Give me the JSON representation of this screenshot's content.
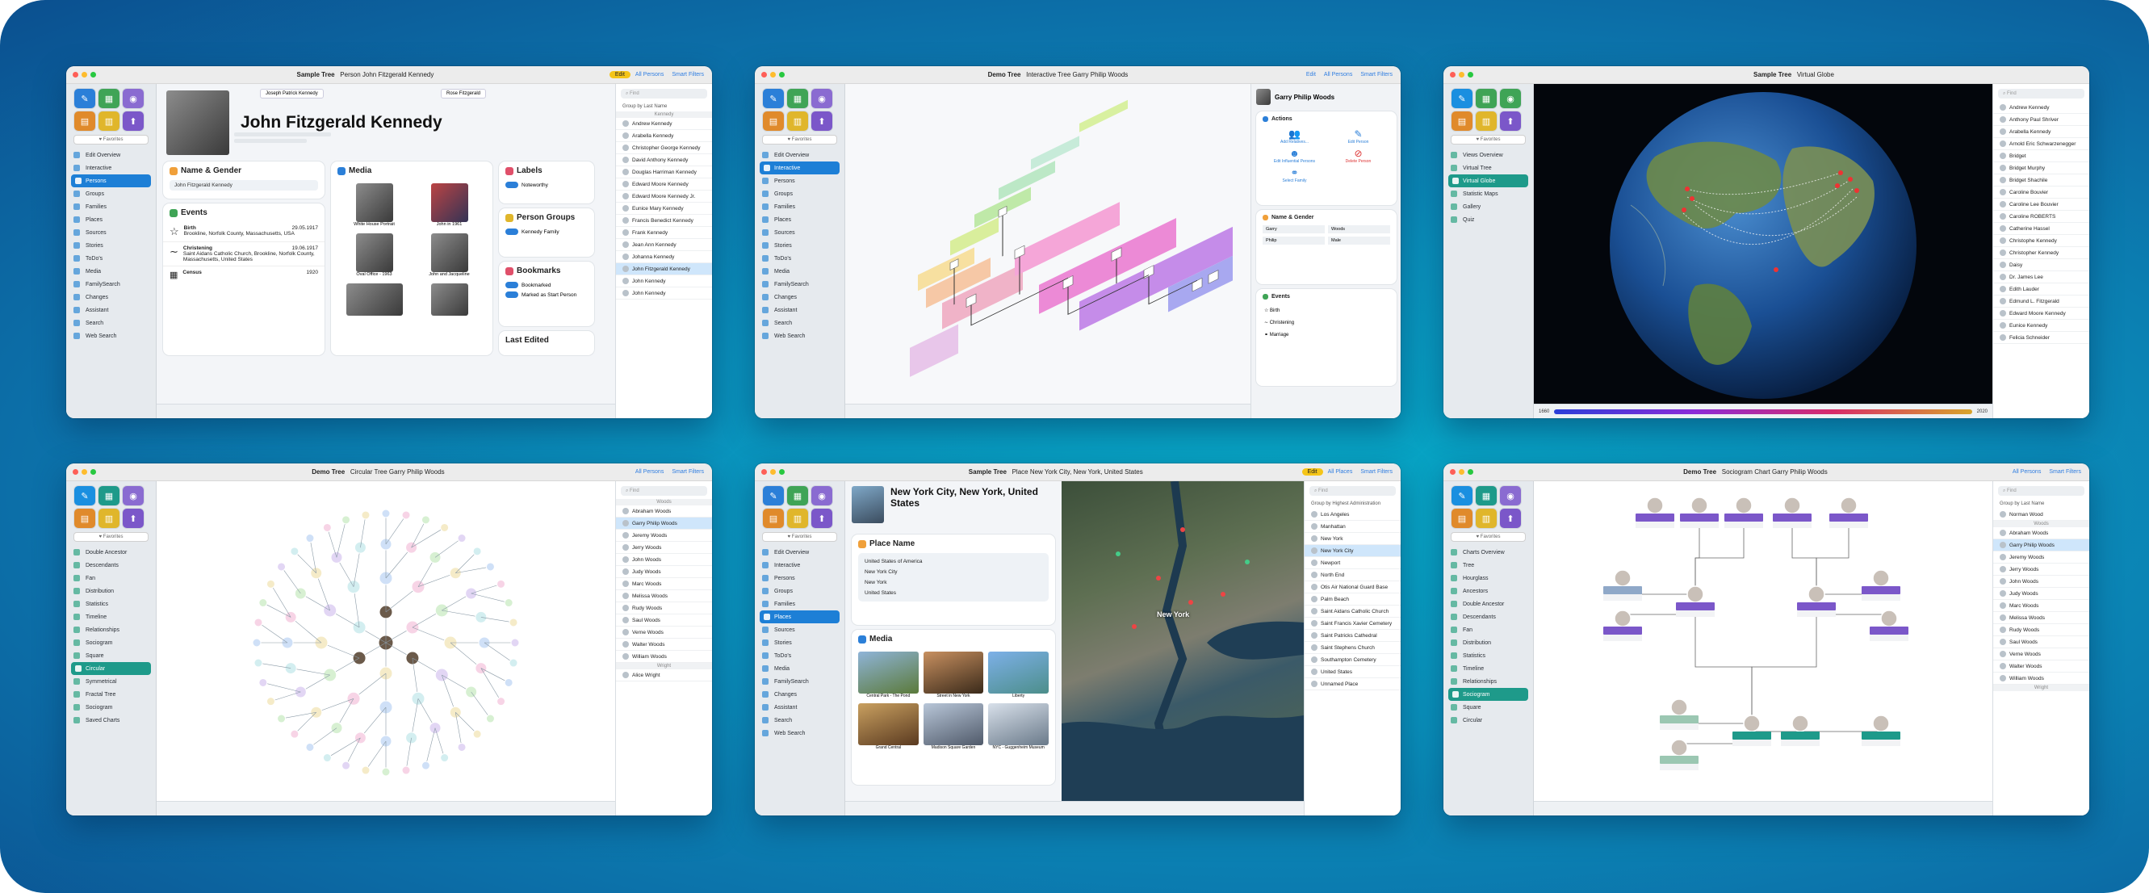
{
  "w1": {
    "title": "Sample Tree",
    "subtitle": "Person John Fitzgerald Kennedy",
    "edit": "Edit",
    "tabs": [
      "All Persons",
      "Smart Filters"
    ],
    "name": "John Fitzgerald Kennedy",
    "father": "Joseph Patrick Kennedy",
    "mother": "Rose Fitzgerald",
    "nav": [
      "Edit Overview",
      "Interactive",
      "Persons",
      "Groups",
      "Families",
      "Places",
      "Sources",
      "Stories",
      "ToDo's",
      "Media",
      "FamilySearch",
      "Changes",
      "Assistant",
      "Search",
      "Web Search"
    ],
    "cards": {
      "name_gender": "Name & Gender",
      "events": "Events",
      "media": "Media",
      "labels": "Labels",
      "person_groups": "Person Groups",
      "bookmarks": "Bookmarks",
      "last_edited": "Last Edited"
    },
    "name_value": "John Fitzgerald Kennedy",
    "events": [
      {
        "type": "Birth",
        "date": "29.05.1917",
        "place": "Brookline, Norfolk County, Massachusetts, USA"
      },
      {
        "type": "Christening",
        "date": "19.06.1917",
        "place": "Saint Aidans Catholic Church, Brookline, Norfolk County, Massachusetts, United States"
      },
      {
        "type": "Census",
        "date": "1920",
        "place": ""
      }
    ],
    "media_items": [
      "White House Portrait",
      "John in 1961",
      "Oval Office - 1963",
      "John and Jacqueline"
    ],
    "label_item": "Noteworthy",
    "group_item": "Kennedy Family",
    "bookmark_items": [
      "Bookmarked",
      "Marked as Start Person"
    ],
    "list_group": "Group by Last Name",
    "list_section": "Kennedy",
    "list": [
      "Andrew Kennedy",
      "Arabella Kennedy",
      "Christopher George Kennedy",
      "David Anthony Kennedy",
      "Douglas Harriman Kennedy",
      "Edward Moore Kennedy",
      "Edward Moore Kennedy Jr.",
      "Eunice Mary Kennedy",
      "Francis Benedict Kennedy",
      "Frank Kennedy",
      "Jean Ann Kennedy",
      "Johanna Kennedy",
      "John Fitzgerald Kennedy",
      "John Kennedy",
      "John Kennedy"
    ]
  },
  "w2": {
    "title": "Demo Tree",
    "subtitle": "Interactive Tree Garry Philip Woods",
    "edit": "Edit",
    "tabs": [
      "All Persons",
      "Smart Filters"
    ],
    "person": "Garry Philip Woods",
    "actions": "Actions",
    "action_items": [
      "Add Relatives...",
      "Edit Person",
      "Edit Influential Persons",
      "Delete Person",
      "Select Family"
    ],
    "name_gender": "Name & Gender",
    "name_fields": [
      "Garry",
      "Woods",
      "Philip",
      "Male"
    ],
    "events": "Events",
    "event_items": [
      "Birth",
      "Christening",
      "Marriage"
    ],
    "nav": [
      "Edit Overview",
      "Interactive",
      "Persons",
      "Groups",
      "Families",
      "Places",
      "Sources",
      "Stories",
      "ToDo's",
      "Media",
      "FamilySearch",
      "Changes",
      "Assistant",
      "Search",
      "Web Search"
    ]
  },
  "w3": {
    "title": "Sample Tree",
    "subtitle": "Virtual Globe",
    "nav": [
      "Views Overview",
      "Virtual Tree",
      "Virtual Globe",
      "Statistic Maps",
      "Gallery",
      "Quiz"
    ],
    "year_start": "1660",
    "year_end": "2020",
    "list": [
      "Andrew Kennedy",
      "Anthony Paul Shriver",
      "Arabella Kennedy",
      "Arnold Eric Schwarzenegger",
      "Bridget",
      "Bridget Murphy",
      "Bridget Shachile",
      "Caroline Bouvier",
      "Caroline Lee Bouvier",
      "Caroline ROBERTS",
      "Catherine Hassel",
      "Christophe Kennedy",
      "Christopher Kennedy",
      "Daisy",
      "Dr. James Lee",
      "Edith Lauder",
      "Edmund L. Fitzgerald",
      "Edward Moore Kennedy",
      "Eunice Kennedy",
      "Felicia Schneider"
    ]
  },
  "w4": {
    "title": "Demo Tree",
    "subtitle": "Circular Tree Garry Philip Woods",
    "tabs": [
      "All Persons",
      "Smart Filters"
    ],
    "nav": [
      "Double Ancestor",
      "Descendants",
      "Fan",
      "Distribution",
      "Statistics",
      "Timeline",
      "Relationships",
      "Sociogram",
      "Square",
      "Circular",
      "Symmetrical",
      "Fractal Tree",
      "Sociogram",
      "Saved Charts"
    ],
    "list_section": "Woods",
    "list": [
      "Abraham Woods",
      "Garry Philip Woods",
      "Jeremy Woods",
      "Jerry Woods",
      "John Woods",
      "Judy Woods",
      "Marc Woods",
      "Melissa Woods",
      "Rudy Woods",
      "Saul Woods",
      "Verne Woods",
      "Walter Woods",
      "William Woods"
    ],
    "list_section2": "Wright",
    "list2": [
      "Alice Wright"
    ]
  },
  "w5": {
    "title": "Sample Tree",
    "subtitle": "Place New York City, New York, United States",
    "edit": "Edit",
    "tabs": [
      "All Places",
      "Smart Filters"
    ],
    "place": "New York City, New York, United States",
    "place_name": "Place Name",
    "place_fields": [
      "United States of America",
      "New York City",
      "New York",
      "United States"
    ],
    "media": "Media",
    "media_items": [
      "Central Park - The Pond",
      "Street in New York",
      "Liberty",
      "Grand Central",
      "Madison Square Garden",
      "NYC - Guggenheim Museum"
    ],
    "map_label": "New York",
    "nav": [
      "Edit Overview",
      "Interactive",
      "Persons",
      "Groups",
      "Families",
      "Places",
      "Sources",
      "Stories",
      "ToDo's",
      "Media",
      "FamilySearch",
      "Changes",
      "Assistant",
      "Search",
      "Web Search"
    ],
    "list_group": "Group by Highest Administration",
    "list": [
      "Los Angeles",
      "Manhattan",
      "New York",
      "New York City",
      "Newport",
      "North End",
      "Otis Air National Guard Base",
      "Palm Beach",
      "Saint Aidans Catholic Church",
      "Saint Francis Xavier Cemetery",
      "Saint Patricks Cathedral",
      "Saint Stephens Church",
      "Southampton Cemetery",
      "United States",
      "Unnamed Place"
    ]
  },
  "w6": {
    "title": "Demo Tree",
    "subtitle": "Sociogram Chart Garry Philip Woods",
    "tabs": [
      "All Persons",
      "Smart Filters"
    ],
    "nav": [
      "Charts Overview",
      "Tree",
      "Hourglass",
      "Ancestors",
      "Double Ancestor",
      "Descendants",
      "Fan",
      "Distribution",
      "Statistics",
      "Timeline",
      "Relationships",
      "Sociogram",
      "Square",
      "Circular"
    ],
    "list_group": "Group by Last Name",
    "list_top": [
      "Norman Wood"
    ],
    "list_section": "Woods",
    "list": [
      "Abraham Woods",
      "Garry Philip Woods",
      "Jeremy Woods",
      "Jerry Woods",
      "John Woods",
      "Judy Woods",
      "Marc Woods",
      "Melissa Woods",
      "Rudy Woods",
      "Saul Woods",
      "Verne Woods",
      "Walter Woods",
      "William Woods"
    ],
    "list_section2": "Wright"
  }
}
